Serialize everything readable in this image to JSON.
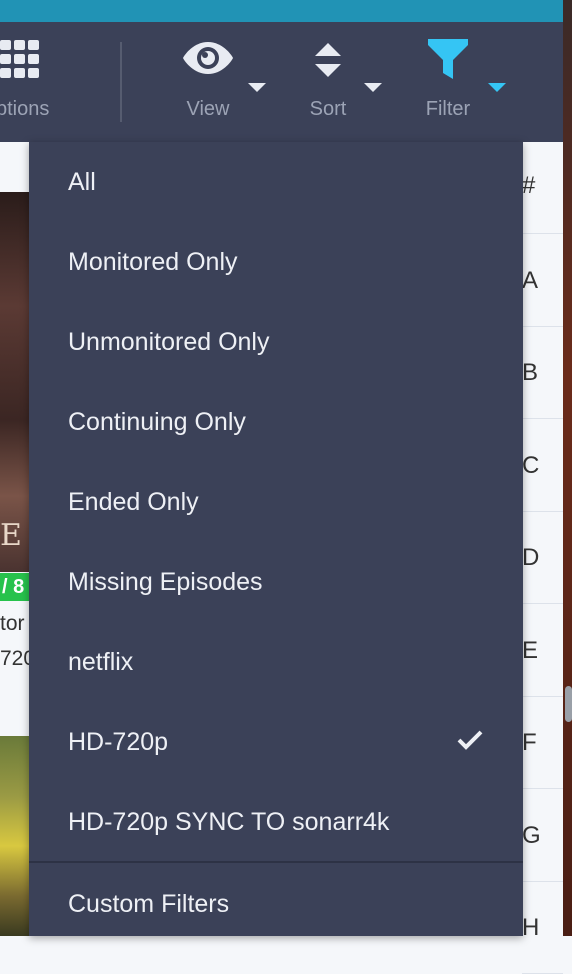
{
  "toolbar": {
    "options_label": "ptions",
    "view_label": "View",
    "sort_label": "Sort",
    "filter_label": "Filter"
  },
  "background": {
    "badge_text": "/ 8",
    "line1": "tor",
    "line2": "720",
    "poster_letter": "E"
  },
  "jump_bar": [
    "#",
    "A",
    "B",
    "C",
    "D",
    "E",
    "F",
    "G",
    "H"
  ],
  "filter_menu": {
    "items": [
      {
        "label": "All",
        "selected": false
      },
      {
        "label": "Monitored Only",
        "selected": false
      },
      {
        "label": "Unmonitored Only",
        "selected": false
      },
      {
        "label": "Continuing Only",
        "selected": false
      },
      {
        "label": "Ended Only",
        "selected": false
      },
      {
        "label": "Missing Episodes",
        "selected": false
      },
      {
        "label": "netflix",
        "selected": false
      },
      {
        "label": "HD-720p",
        "selected": true
      },
      {
        "label": "HD-720p SYNC TO sonarr4k",
        "selected": false
      }
    ],
    "custom_filters_label": "Custom Filters"
  },
  "colors": {
    "toolbar_bg": "#3b4158",
    "accent": "#35c5f4",
    "topbar": "#2193b5",
    "badge_green": "#27c24c"
  }
}
